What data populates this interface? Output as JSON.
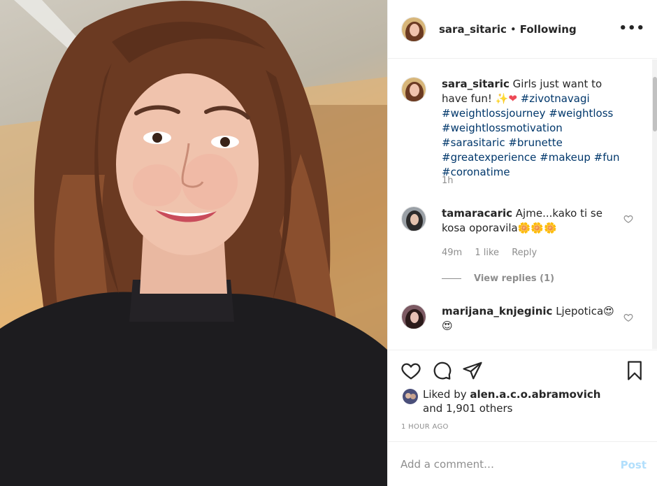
{
  "header": {
    "username": "sara_sitaric",
    "separator": "•",
    "follow_status": "Following",
    "more_icon": "more-horizontal-icon"
  },
  "caption": {
    "username": "sara_sitaric",
    "text_before": "Girls just want to have fun! ✨",
    "emoji_heart": "❤",
    "hashtags": "#zivotnavagi #weightlossjourney #weightloss #weightlossmotivation #sarasitaric #brunette #greatexperience #makeup #fun #coronatime",
    "time": "1h"
  },
  "comments": [
    {
      "username": "tamaracaric",
      "text": "Ajme...kako ti se kosa oporavila🌼🌼🌼",
      "time": "49m",
      "likes": "1 like",
      "reply": "Reply",
      "view_replies": "View replies (1)"
    },
    {
      "username": "marijana_knjeginic",
      "text": "Ljepotica😍😍"
    }
  ],
  "actions": {
    "like_icon": "heart-icon",
    "comment_icon": "comment-icon",
    "share_icon": "send-icon",
    "save_icon": "bookmark-icon"
  },
  "likes": {
    "prefix": "Liked by ",
    "user": "alen.a.c.o.abramovich",
    "suffix": " and 1,901 others"
  },
  "timestamp": "1 HOUR AGO",
  "add_comment": {
    "placeholder": "Add a comment…",
    "post_label": "Post"
  },
  "colors": {
    "hashtag": "#00376b",
    "muted": "#8e8e8e",
    "post_disabled": "#b2dffc",
    "heart": "#ed4956"
  }
}
